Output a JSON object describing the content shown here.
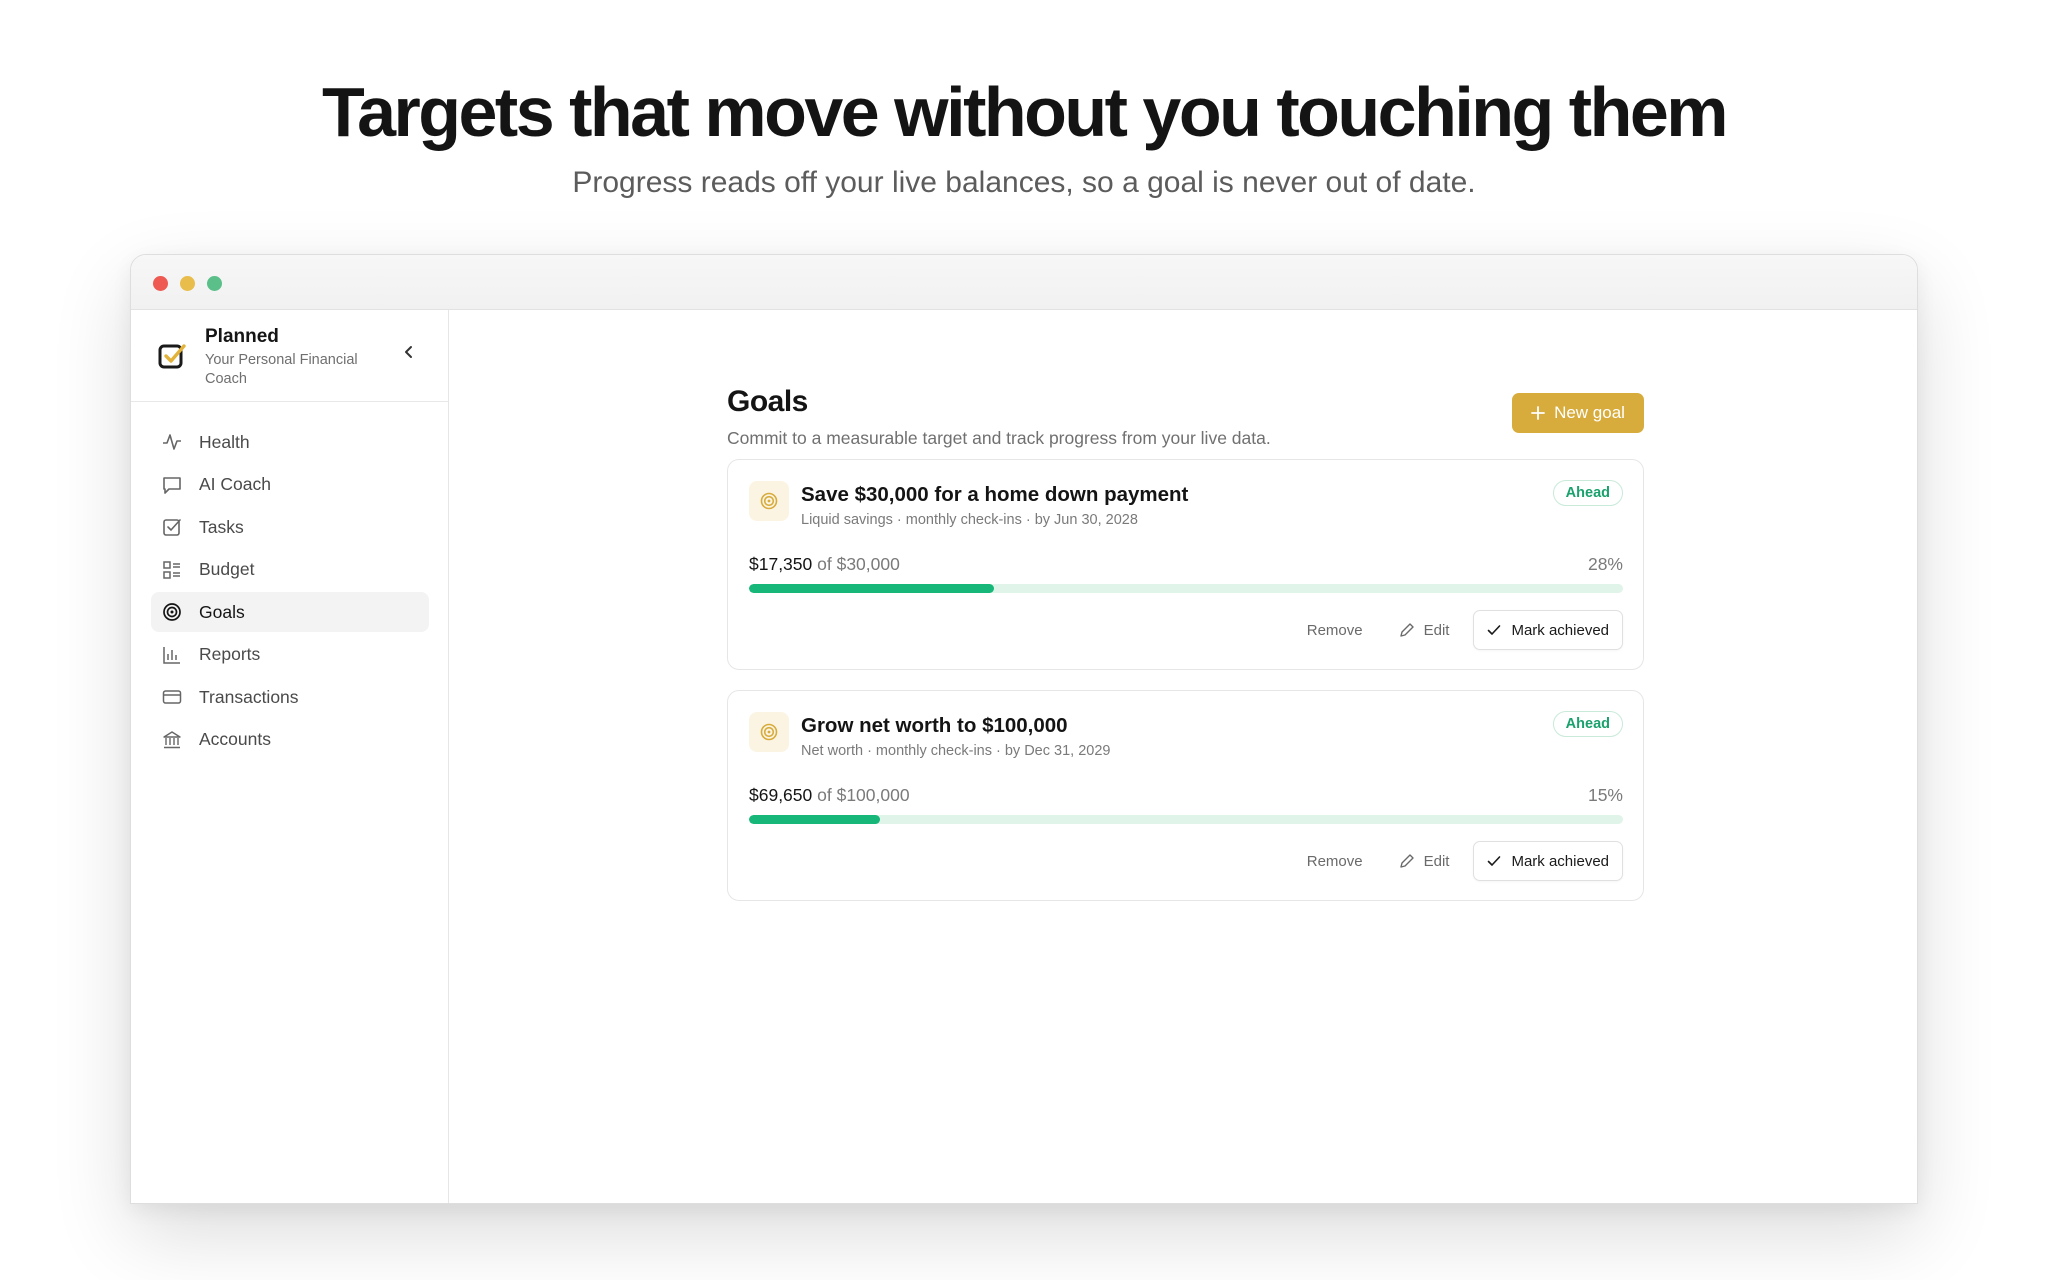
{
  "hero": {
    "title": "Targets that move without you touching them",
    "subtitle": "Progress reads off your live balances, so a goal is never out of date."
  },
  "app": {
    "name": "Planned",
    "tagline": "Your Personal Financial Coach"
  },
  "sidebar": {
    "items": [
      {
        "label": "Health",
        "icon": "pulse-icon"
      },
      {
        "label": "AI Coach",
        "icon": "chat-icon"
      },
      {
        "label": "Tasks",
        "icon": "checkbox-icon"
      },
      {
        "label": "Budget",
        "icon": "list-icon"
      },
      {
        "label": "Goals",
        "icon": "target-icon",
        "active": true
      },
      {
        "label": "Reports",
        "icon": "bar-chart-icon"
      },
      {
        "label": "Transactions",
        "icon": "card-icon"
      },
      {
        "label": "Accounts",
        "icon": "bank-icon"
      }
    ]
  },
  "goals": {
    "title": "Goals",
    "subtitle": "Commit to a measurable target and track progress from your live data.",
    "new_button": "New goal",
    "cards": [
      {
        "title": "Save $30,000 for a home down payment",
        "meta": "Liquid savings · monthly check-ins · by Jun 30, 2028",
        "status": "Ahead",
        "current": "$17,350",
        "of_text": " of $30,000",
        "percent_label": "28%",
        "progress": 0.28,
        "remove": "Remove",
        "edit": "Edit",
        "achieve": "Mark achieved"
      },
      {
        "title": "Grow net worth to $100,000",
        "meta": "Net worth · monthly check-ins · by Dec 31, 2029",
        "status": "Ahead",
        "current": "$69,650",
        "of_text": " of $100,000",
        "percent_label": "15%",
        "progress": 0.15,
        "remove": "Remove",
        "edit": "Edit",
        "achieve": "Mark achieved"
      }
    ]
  },
  "colors": {
    "accent": "#d7ac3c",
    "progress": "#16b778",
    "badge": "#1aa16c"
  }
}
